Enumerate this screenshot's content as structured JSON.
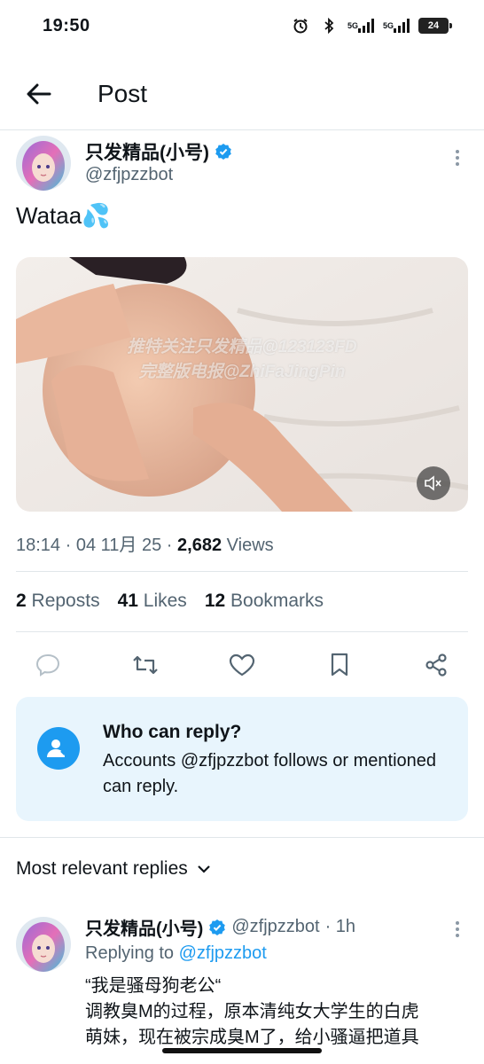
{
  "status_bar": {
    "time": "19:50",
    "battery": "24",
    "icons": [
      "alarm-icon",
      "bluetooth-icon",
      "signal-5g-icon",
      "signal-5g-icon",
      "battery-icon"
    ],
    "signal_1": "5G",
    "signal_2": "5G"
  },
  "header": {
    "title": "Post"
  },
  "post": {
    "author_name": "只发精品(小号)",
    "author_handle": "@zfjpzzbot",
    "text": "Wataa💦",
    "watermark_line1": "推特关注只发精品@123123FD",
    "watermark_line2": "完整版电报@ZhiFaJingPin",
    "time": "18:14",
    "date": "04 11月 25",
    "views_count": "2,682",
    "views_label": "Views",
    "sep": "·"
  },
  "stats": {
    "reposts_count": "2",
    "reposts_label": "Reposts",
    "likes_count": "41",
    "likes_label": "Likes",
    "bookmarks_count": "12",
    "bookmarks_label": "Bookmarks"
  },
  "who_can_reply": {
    "title": "Who can reply?",
    "description": "Accounts @zfjpzzbot follows or mentioned can reply."
  },
  "replies": {
    "sort_label": "Most relevant replies",
    "items": [
      {
        "name": "只发精品(小号)",
        "handle": "@zfjpzzbot",
        "age": "· 1h",
        "replying_label": "Replying to",
        "replying_handle": "@zfjpzzbot",
        "text_line1": "“我是骚母狗老公“",
        "text_line2": "调教臭M的过程，原本清纯女大学生的白虎",
        "text_line3": "萌妹，现在被宗成臭M了，给小骚逼把道具"
      }
    ]
  },
  "colors": {
    "accent": "#1d9bf0",
    "text": "#0f1419",
    "muted": "#536471",
    "reply_box": "#e8f5fd"
  }
}
